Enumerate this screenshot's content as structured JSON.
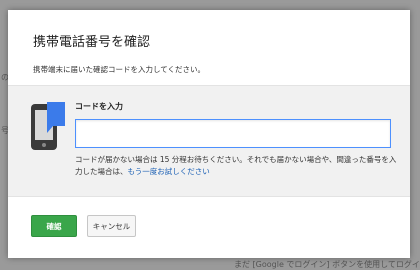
{
  "background": {
    "fragment_left_1": "の",
    "fragment_left_2": "号",
    "fragment_bottom": "まだ [Google でログイン] ボタンを使用してログイン"
  },
  "dialog": {
    "title": "携帯電話番号を確認",
    "subtitle": "携帯端末に届いた確認コードを入力してください。",
    "field_label": "コードを入力",
    "code_value": "",
    "help_text": "コードが届かない場合は 15 分程お待ちください。それでも届かない場合や、間違った番号を入力した場合は、",
    "retry_link": "もう一度お試しください",
    "confirm_label": "確認",
    "cancel_label": "キャンセル"
  },
  "colors": {
    "accent_blue": "#3b7bea",
    "confirm_green": "#3aa64a",
    "input_focus": "#4d90fe"
  },
  "icons": [
    "phone-icon"
  ]
}
